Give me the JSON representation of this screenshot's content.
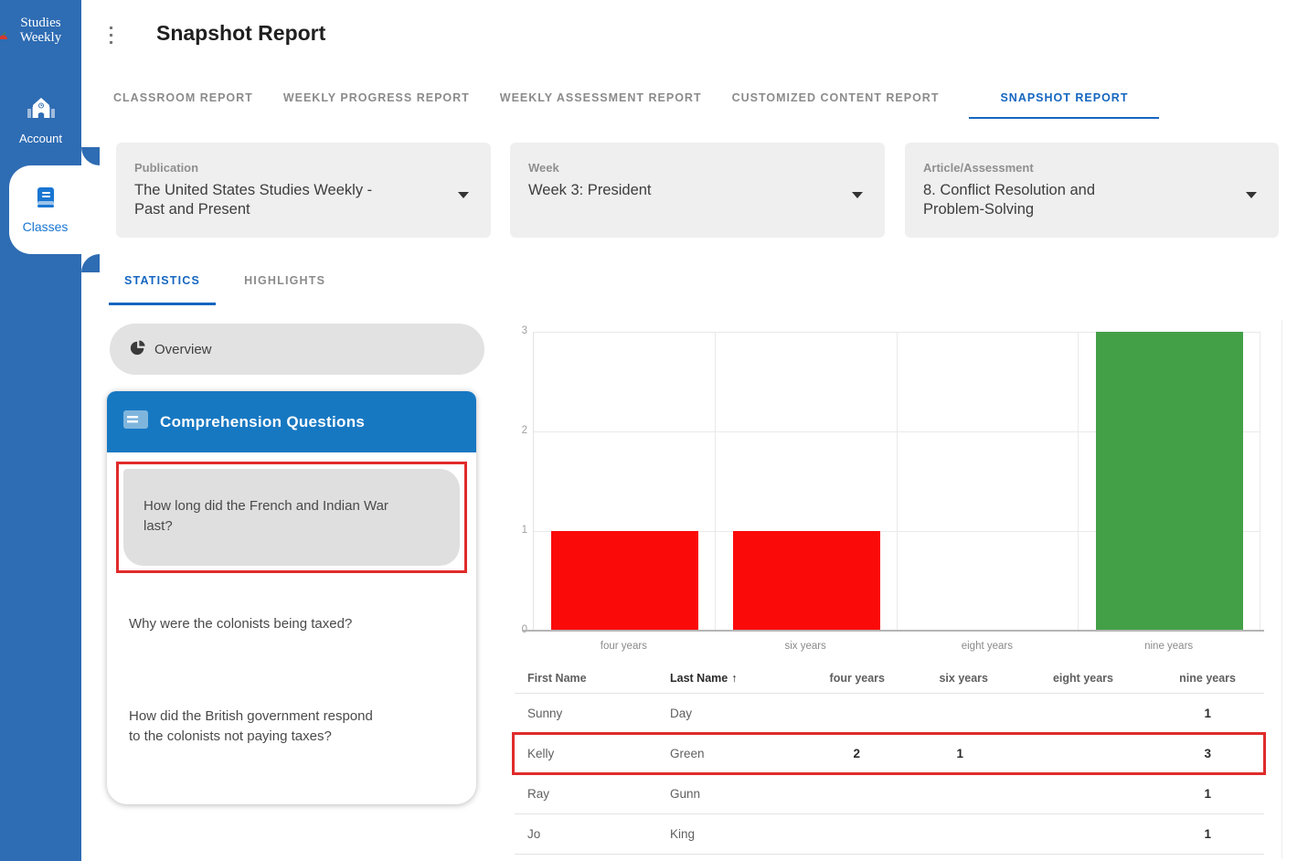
{
  "sidebar": {
    "logo": {
      "line1": "Studies",
      "line2": "Weekly"
    },
    "items": [
      {
        "label": "Account"
      },
      {
        "label": "Classes"
      }
    ]
  },
  "header": {
    "title": "Snapshot Report"
  },
  "tabs": {
    "items": [
      {
        "label": "CLASSROOM REPORT",
        "active": false
      },
      {
        "label": "WEEKLY PROGRESS REPORT",
        "active": false
      },
      {
        "label": "WEEKLY ASSESSMENT REPORT",
        "active": false
      },
      {
        "label": "CUSTOMIZED CONTENT REPORT",
        "active": false
      },
      {
        "label": "SNAPSHOT REPORT",
        "active": true
      }
    ]
  },
  "filters": [
    {
      "label": "Publication",
      "value": "The United States Studies Weekly -\nPast and Present"
    },
    {
      "label": "Week",
      "value": "Week 3: President"
    },
    {
      "label": "Article/Assessment",
      "value": "8. Conflict Resolution and\nProblem-Solving"
    }
  ],
  "subtabs": {
    "items": [
      {
        "label": "STATISTICS",
        "active": true
      },
      {
        "label": "HIGHLIGHTS",
        "active": false
      }
    ]
  },
  "overview": {
    "label": "Overview"
  },
  "questions_panel": {
    "title": "Comprehension Questions",
    "questions": [
      {
        "text": "How long did the French and Indian War\nlast?",
        "selected": true
      },
      {
        "text": "Why were the colonists being taxed?",
        "selected": false
      },
      {
        "text": "How did the British government respond\nto the colonists not paying taxes?",
        "selected": false
      }
    ]
  },
  "chart_data": {
    "type": "bar",
    "categories": [
      "four years",
      "six years",
      "eight years",
      "nine years"
    ],
    "values": [
      1,
      1,
      0,
      3
    ],
    "colors": [
      "#fb0a0a",
      "#fb0a0a",
      "#fb0a0a",
      "#43a047"
    ],
    "ylim": [
      0,
      3
    ],
    "yticks": [
      0,
      1,
      2,
      3
    ],
    "grid": true,
    "legend": "none",
    "title": "",
    "xlabel": "",
    "ylabel": ""
  },
  "table": {
    "sort_indicator": "↑",
    "sorted_column": "Last Name",
    "columns": [
      "First Name",
      "Last Name",
      "four years",
      "six years",
      "eight years",
      "nine years"
    ],
    "rows": [
      {
        "cells": [
          "Sunny",
          "Day",
          "",
          "",
          "",
          "1"
        ],
        "highlighted": false
      },
      {
        "cells": [
          "Kelly",
          "Green",
          "2",
          "1",
          "",
          "3"
        ],
        "highlighted": true
      },
      {
        "cells": [
          "Ray",
          "Gunn",
          "",
          "",
          "",
          "1"
        ],
        "highlighted": false
      },
      {
        "cells": [
          "Jo",
          "King",
          "",
          "",
          "",
          "1"
        ],
        "highlighted": false
      }
    ]
  },
  "colors": {
    "sidebar_blue": "#2e6cb3",
    "accent_blue": "#1566c0",
    "panel_header_blue": "#1778c2",
    "bar_red": "#fb0a0a",
    "bar_green": "#43a047",
    "annotation_red": "#e02b2b"
  }
}
